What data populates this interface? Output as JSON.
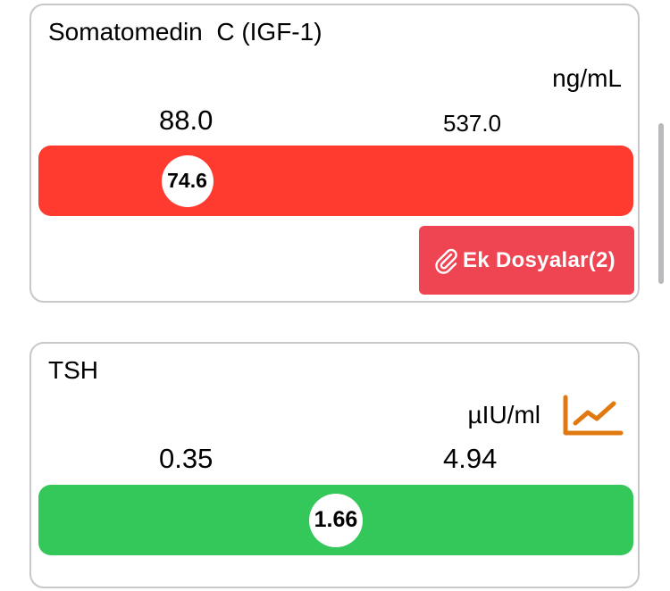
{
  "colors": {
    "out_of_range_bar": "#ff3b30",
    "in_range_bar": "#34c759",
    "attach_button": "#ef4452",
    "trend_icon": "#e07a10",
    "card_border": "#c7c7cc"
  },
  "results": [
    {
      "name": "Somatomedin  C (IGF-1)",
      "unit": "ng/mL",
      "range_low": "88.0",
      "range_high": "537.0",
      "value": "74.6",
      "value_position_fraction": 0.25,
      "status": "out-of-range",
      "attachments_label": "Ek Dosyalar(2)",
      "attachments_icon": "paperclip-icon"
    },
    {
      "name": "TSH",
      "unit": "µIU/ml",
      "range_low": "0.35",
      "range_high": "4.94",
      "value": "1.66",
      "value_position_fraction": 0.5,
      "status": "in-range",
      "trend_icon": "trend-chart-icon"
    }
  ]
}
